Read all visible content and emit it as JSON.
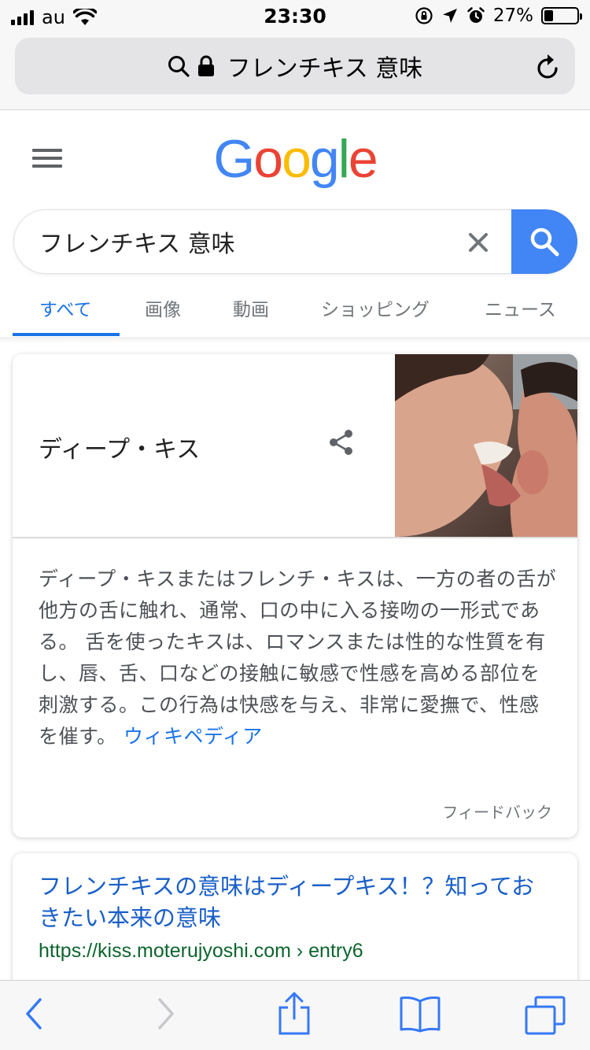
{
  "status_bar": {
    "carrier": "au",
    "time": "23:30",
    "battery_percent": "27%",
    "battery_level": 0.27
  },
  "browser": {
    "url_text": "フレンチキス 意味"
  },
  "google": {
    "logo_letters": [
      "G",
      "o",
      "o",
      "g",
      "l",
      "e"
    ],
    "logo_colors": [
      "#4285f4",
      "#ea4335",
      "#fbbc05",
      "#4285f4",
      "#34a853",
      "#ea4335"
    ],
    "search_value": "フレンチキス 意味",
    "tabs": [
      {
        "label": "すべて"
      },
      {
        "label": "画像"
      },
      {
        "label": "動画"
      },
      {
        "label": "ショッピング"
      },
      {
        "label": "ニュース"
      }
    ]
  },
  "knowledge_panel": {
    "title": "ディープ・キス",
    "description": "ディープ・キスまたはフレンチ・キスは、一方の者の舌が他方の舌に触れ、通常、口の中に入る接吻の一形式である。 舌を使ったキスは、ロマンスまたは性的な性質を有し、唇、舌、口などの接触に敏感で性感を高める部位を刺激する。この行為は快感を与え、非常に愛撫で、性感を催す。",
    "source_link": "ウィキペディア",
    "feedback": "フィードバック"
  },
  "result": {
    "title": "フレンチキスの意味はディープキス！？知っておきたい本来の意味",
    "url": "https://kiss.moterujyoshi.com › entry6"
  },
  "colors": {
    "accent_blue": "#1a73e8",
    "search_button": "#4285f4",
    "result_url_green": "#0d652d",
    "ios_tint": "#3478f6"
  }
}
